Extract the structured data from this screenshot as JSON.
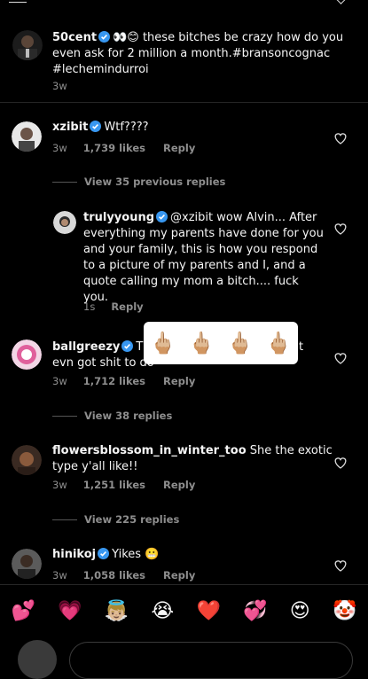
{
  "caption": {
    "username": "50cent",
    "text": "👀😊 these bitches be crazy how do you even ask for 2 million a month.#bransoncognac #lechemindurroi",
    "line1": "👀😊 these bitches be crazy how do you",
    "line2": "even ask for 2 million a month.#bransoncognac",
    "line3": "#lechemindurroi",
    "time": "3w"
  },
  "comments": [
    {
      "username": "xzibit",
      "text": "Wtf????",
      "time": "3w",
      "likes": "1,739 likes",
      "reply": "Reply",
      "view_replies": "View 35 previous replies"
    },
    {
      "username": "trulyyoung",
      "text_l1": "@xzibit wow Alvin... After",
      "text_l2": "everything my parents have done for you",
      "text_l3": "and your family, this is how you respond",
      "text_l4": "to a picture of my parents and I, and a",
      "text_l5": "quote calling my mom a bitch.... fuck",
      "text_l6": "you.",
      "time": "1s",
      "reply": "Reply"
    },
    {
      "username": "ballgreezy",
      "text_l1": "Th",
      "text_l1_end": "t",
      "text_l2": "evn got shit to do",
      "time": "3w",
      "likes": "1,712 likes",
      "reply": "Reply",
      "view_replies": "View 38 replies"
    },
    {
      "username": "flowersblossom_in_winter_too",
      "text_l1": "She the exotic",
      "text_l2": "type y'all like!!",
      "time": "3w",
      "likes": "1,251 likes",
      "reply": "Reply",
      "view_replies": "View 225 replies"
    },
    {
      "username": "hinikoj",
      "text": "Yikes 😬",
      "time": "3w",
      "likes": "1,058 likes",
      "reply": "Reply"
    }
  ],
  "reaction_popup": [
    "🖕🏼",
    "🖕🏼",
    "🖕🏼",
    "🖕🏼"
  ],
  "emoji_bar": [
    "💕",
    "💗",
    "👼🏼",
    "😭",
    "❤️",
    "💞",
    "😍",
    "🤡"
  ],
  "colors": {
    "background": "#000000",
    "text": "#f5f5f5",
    "muted": "#8e8e8e",
    "verified": "#3897f0"
  }
}
